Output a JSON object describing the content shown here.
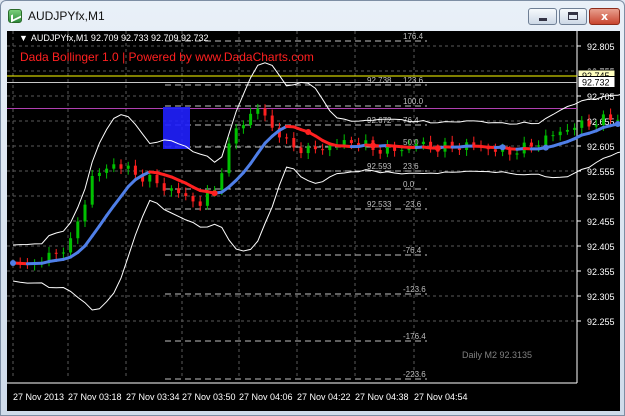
{
  "window": {
    "title": "AUDJPYfx,M1",
    "close_glyph": "x"
  },
  "chart": {
    "symbol_line": "AUDJPYfx,M1  92.709 92.733 92.709 92.732",
    "indicator_label": "Dada Bollinger 1.0 | Powered by www.DadaCharts.com",
    "price_ticks": [
      "92.805",
      "92.755",
      "92.705",
      "92.655",
      "92.605",
      "92.555",
      "92.505",
      "92.455",
      "92.405",
      "92.355",
      "92.305",
      "92.255"
    ],
    "current_prices": [
      "92.745",
      "92.732"
    ],
    "time_ticks": [
      "27 Nov 2013",
      "27 Nov 03:18",
      "27 Nov 03:34",
      "27 Nov 03:50",
      "27 Nov 04:06",
      "27 Nov 04:22",
      "27 Nov 04:38",
      "27 Nov 04:54"
    ],
    "fib_levels": [
      "176.4",
      "123.6",
      "100.0",
      "76.4",
      "50.0",
      "23.6",
      "0.0",
      "-23.6",
      "-76.4",
      "-123.6",
      "-176.4",
      "-223.6"
    ],
    "fib_prices": [
      "92.738",
      "92.672",
      "92.593",
      "92.533"
    ],
    "daily_label": "Daily M2 92.3135",
    "colors": {
      "bull_candle": "#00c000",
      "bear_candle": "#ff2020",
      "bands": "#ffffff",
      "ma_up": "#4f7fe8",
      "ma_down": "#ff2020",
      "grid": "#5a5a5a",
      "fib": "#bfbfbf",
      "price_line": "#ffff00",
      "box": "#2020ff"
    }
  }
}
